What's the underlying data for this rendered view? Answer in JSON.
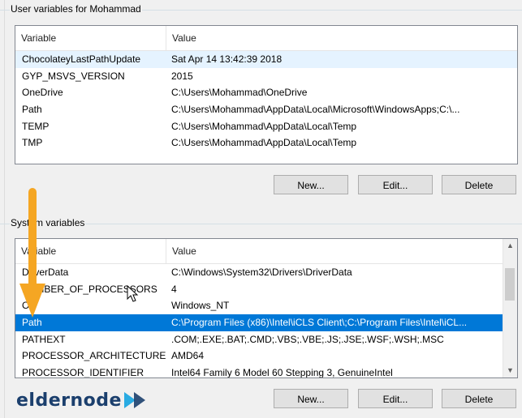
{
  "user_section": {
    "label": "User variables for Mohammad",
    "columns": {
      "variable": "Variable",
      "value": "Value"
    },
    "rows": [
      {
        "name": "ChocolateyLastPathUpdate",
        "value": "Sat Apr 14 13:42:39 2018"
      },
      {
        "name": "GYP_MSVS_VERSION",
        "value": "2015"
      },
      {
        "name": "OneDrive",
        "value": "C:\\Users\\Mohammad\\OneDrive"
      },
      {
        "name": "Path",
        "value": "C:\\Users\\Mohammad\\AppData\\Local\\Microsoft\\WindowsApps;C:\\..."
      },
      {
        "name": "TEMP",
        "value": "C:\\Users\\Mohammad\\AppData\\Local\\Temp"
      },
      {
        "name": "TMP",
        "value": "C:\\Users\\Mohammad\\AppData\\Local\\Temp"
      }
    ],
    "buttons": {
      "new": "New...",
      "edit": "Edit...",
      "delete": "Delete"
    }
  },
  "system_section": {
    "label": "System variables",
    "columns": {
      "variable": "Variable",
      "value": "Value"
    },
    "rows": [
      {
        "name": "DriverData",
        "value": "C:\\Windows\\System32\\Drivers\\DriverData"
      },
      {
        "name": "NUMBER_OF_PROCESSORS",
        "value": "4"
      },
      {
        "name": "OS",
        "value": "Windows_NT"
      },
      {
        "name": "Path",
        "value": "C:\\Program Files (x86)\\Intel\\iCLS Client\\;C:\\Program Files\\Intel\\iCL..."
      },
      {
        "name": "PATHEXT",
        "value": ".COM;.EXE;.BAT;.CMD;.VBS;.VBE;.JS;.JSE;.WSF;.WSH;.MSC"
      },
      {
        "name": "PROCESSOR_ARCHITECTURE",
        "value": "AMD64"
      },
      {
        "name": "PROCESSOR_IDENTIFIER",
        "value": "Intel64 Family 6 Model 60 Stepping 3, GenuineIntel"
      }
    ],
    "buttons": {
      "new": "New...",
      "edit": "Edit...",
      "delete": "Delete"
    }
  },
  "logo": {
    "text": "eldernode"
  },
  "colors": {
    "selection": "#0078d7",
    "arrow": "#f5a623",
    "logo_navy": "#1b3f6d",
    "logo_cyan": "#29abe2"
  }
}
